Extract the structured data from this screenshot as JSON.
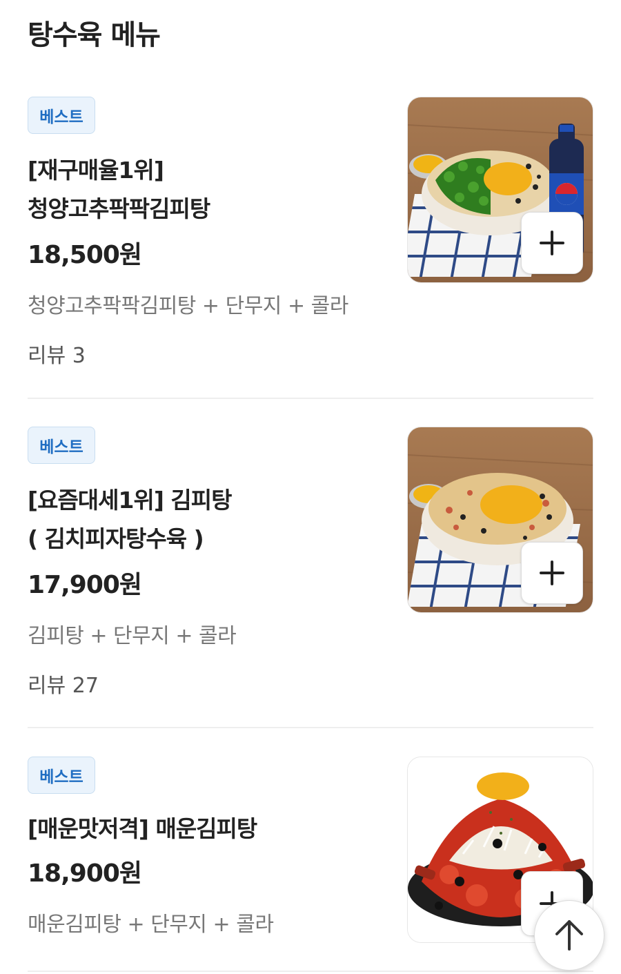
{
  "section_title": "탕수육 메뉴",
  "items": [
    {
      "badge": "베스트",
      "name_lines": [
        "[재구매율1위]",
        "청양고추팍팍김피탕"
      ],
      "price": "18,500원",
      "description": "청양고추팍팍김피탕 + 단무지 + 콜라",
      "review": "리뷰 3",
      "image_icon": "kimpi-tang-green-pepper-photo"
    },
    {
      "badge": "베스트",
      "name_lines": [
        "[요즘대세1위] 김피탕",
        "( 김치피자탕수육 )"
      ],
      "price": "17,900원",
      "description": "김피탕 + 단무지 + 콜라",
      "review": "리뷰 27",
      "image_icon": "kimpi-tang-photo"
    },
    {
      "badge": "베스트",
      "name_lines": [
        "[매운맛저격] 매운김피탕"
      ],
      "price": "18,900원",
      "description": "매운김피탕 + 단무지 + 콜라",
      "image_icon": "spicy-kimpi-tang-photo"
    }
  ],
  "icons": {
    "add": "plus-icon",
    "scroll_top": "arrow-up-icon"
  },
  "colors": {
    "badge_text": "#1f6dc2",
    "badge_bg": "#eaf3fc",
    "description": "#777777",
    "divider": "#eeeeee"
  }
}
